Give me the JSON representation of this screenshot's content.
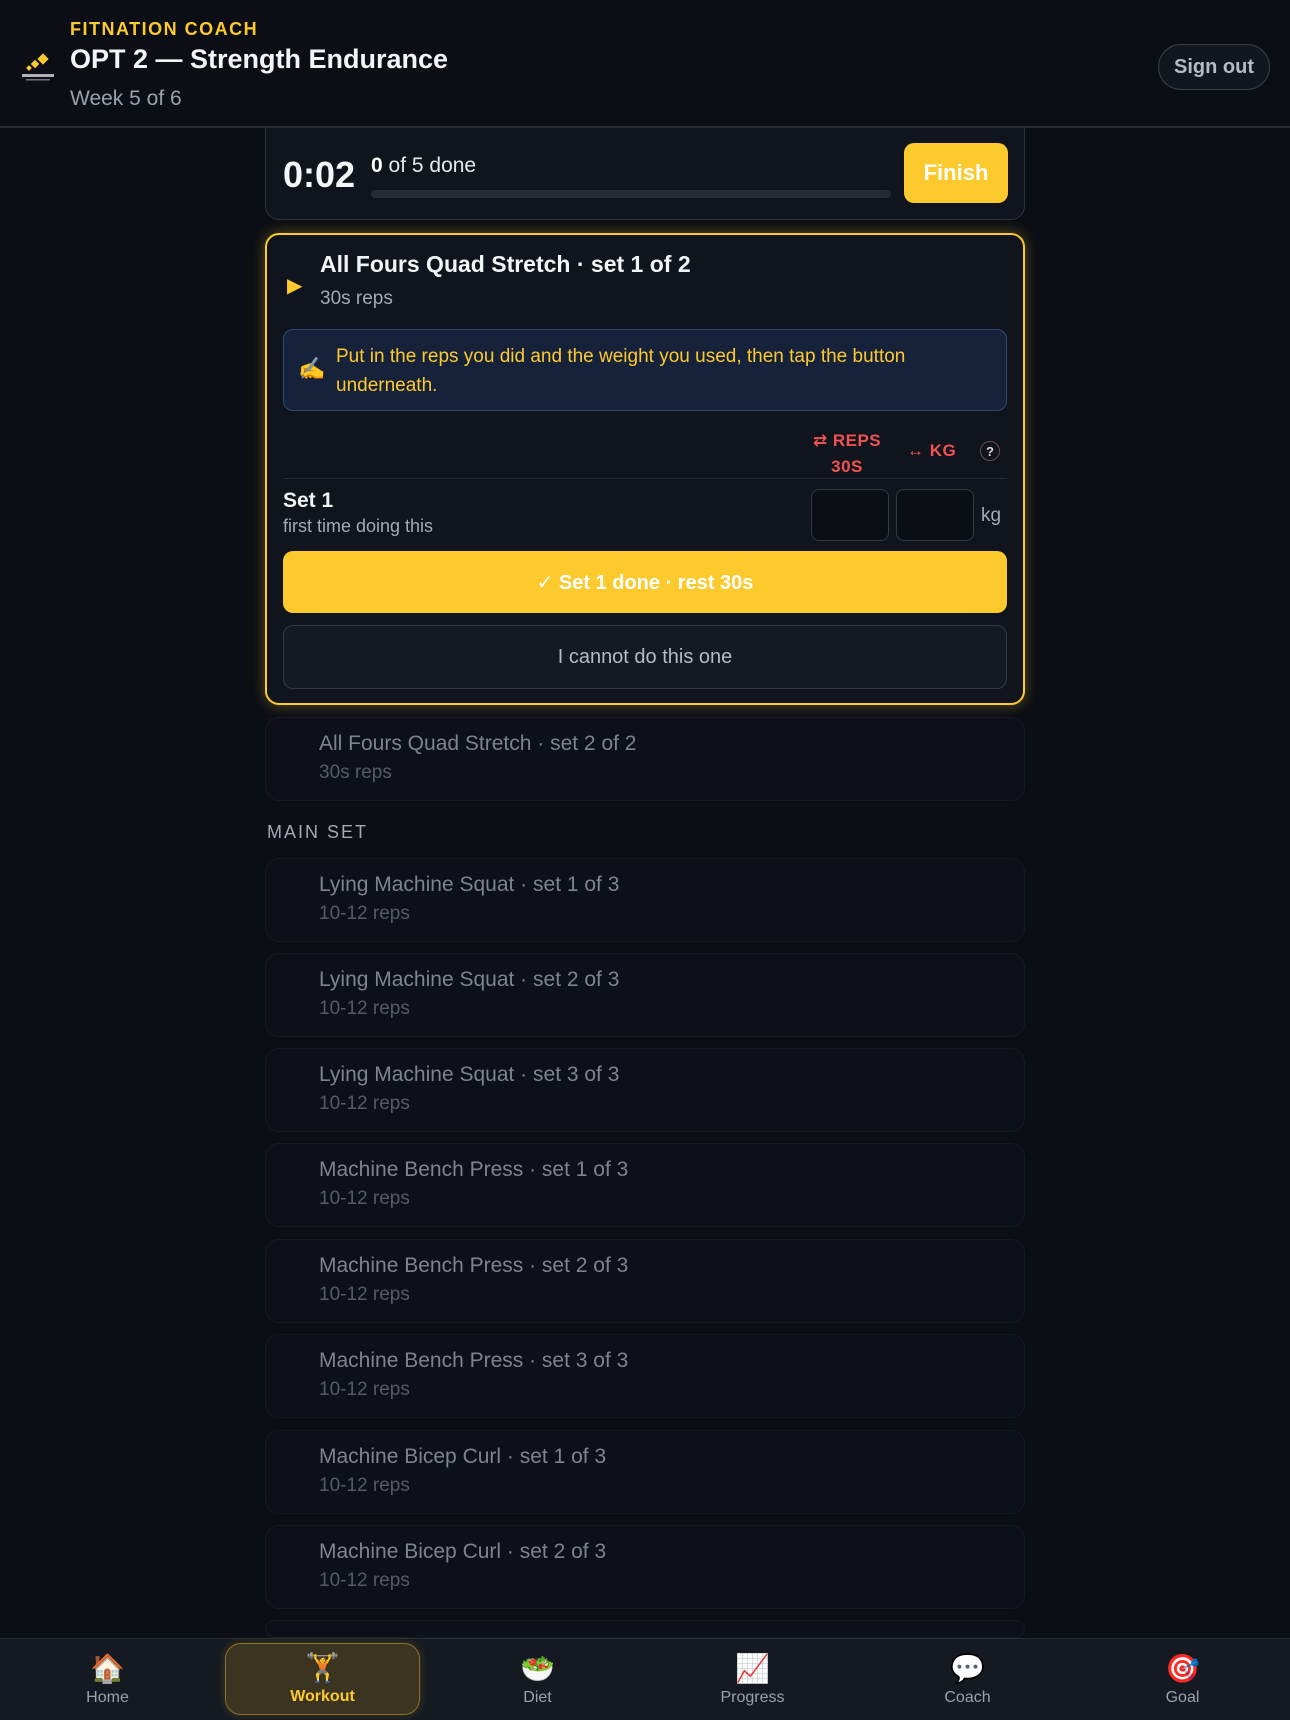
{
  "header": {
    "brand": "FITNATION COACH",
    "title": "OPT 2 — Strength Endurance",
    "week": "Week 5 of 6",
    "signout_label": "Sign out"
  },
  "session": {
    "timer": "0:02",
    "done_count": "0",
    "done_suffix": " of 5 done",
    "progress_fraction": 0,
    "finish_label": "Finish"
  },
  "active": {
    "title": "All Fours Quad Stretch · set 1 of 2",
    "subtitle": "30s reps",
    "hint": "Put in the reps you did and the weight you used, then tap the button underneath.",
    "reps_header": "REPS",
    "reps_sub": "30S",
    "kg_header": "KG",
    "help": "?",
    "set_label": "Set 1",
    "set_note": "first time doing this",
    "reps_value": "",
    "kg_value": "",
    "unit": "kg",
    "done_button": "✓ Set 1 done · rest 30s",
    "skip_button": "I cannot do this one"
  },
  "warmup_next": {
    "title": "All Fours Quad Stretch · set 2 of 2",
    "subtitle": "30s reps"
  },
  "main_set_label": "MAIN SET",
  "main_set": [
    {
      "title": "Lying Machine Squat · set 1 of 3",
      "subtitle": "10-12 reps"
    },
    {
      "title": "Lying Machine Squat · set 2 of 3",
      "subtitle": "10-12 reps"
    },
    {
      "title": "Lying Machine Squat · set 3 of 3",
      "subtitle": "10-12 reps"
    },
    {
      "title": "Machine Bench Press · set 1 of 3",
      "subtitle": "10-12 reps"
    },
    {
      "title": "Machine Bench Press · set 2 of 3",
      "subtitle": "10-12 reps"
    },
    {
      "title": "Machine Bench Press · set 3 of 3",
      "subtitle": "10-12 reps"
    },
    {
      "title": "Machine Bicep Curl · set 1 of 3",
      "subtitle": "10-12 reps"
    },
    {
      "title": "Machine Bicep Curl · set 2 of 3",
      "subtitle": "10-12 reps"
    }
  ],
  "nav": [
    {
      "icon": "🏠",
      "icon_name": "home-icon",
      "label": "Home",
      "active": false
    },
    {
      "icon": "🏋️",
      "icon_name": "workout-icon",
      "label": "Workout",
      "active": true
    },
    {
      "icon": "🥗",
      "icon_name": "diet-icon",
      "label": "Diet",
      "active": false
    },
    {
      "icon": "📈",
      "icon_name": "progress-icon",
      "label": "Progress",
      "active": false
    },
    {
      "icon": "💬",
      "icon_name": "coach-icon",
      "label": "Coach",
      "active": false
    },
    {
      "icon": "🎯",
      "icon_name": "goal-icon",
      "label": "Goal",
      "active": false
    }
  ],
  "colors": {
    "accent": "#fdca2e",
    "background": "#0b0e14",
    "alert": "#ef5350"
  }
}
